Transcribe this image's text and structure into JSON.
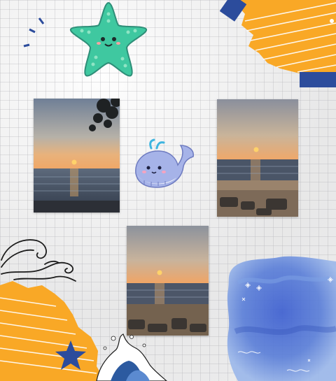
{
  "canvas": {
    "background": "#f3f3f2",
    "grid_color": "#c8c8cc"
  },
  "colors": {
    "orange": "#f9a826",
    "navy": "#2c4c9c",
    "teal_starfish": "#3fc8a0",
    "whale": "#a6b3e8",
    "watercolor_blue": "#5b7fd8"
  },
  "decorations": {
    "top_right": "orange-torn-paper-with-stripes",
    "bottom_left": "orange-torn-paper-with-stripes",
    "starfish": "starfish-sticker",
    "whale": "whale-sticker",
    "wave_outline": "wave-line-drawing",
    "wave_splash": "wave-splash-illustration",
    "watercolor": "blue-watercolor-splash",
    "star": "navy-star"
  },
  "photos": [
    {
      "subject": "sunset-over-sea-with-tree"
    },
    {
      "subject": "sunset-over-beach"
    },
    {
      "subject": "sunset-over-beach-rocks"
    }
  ]
}
